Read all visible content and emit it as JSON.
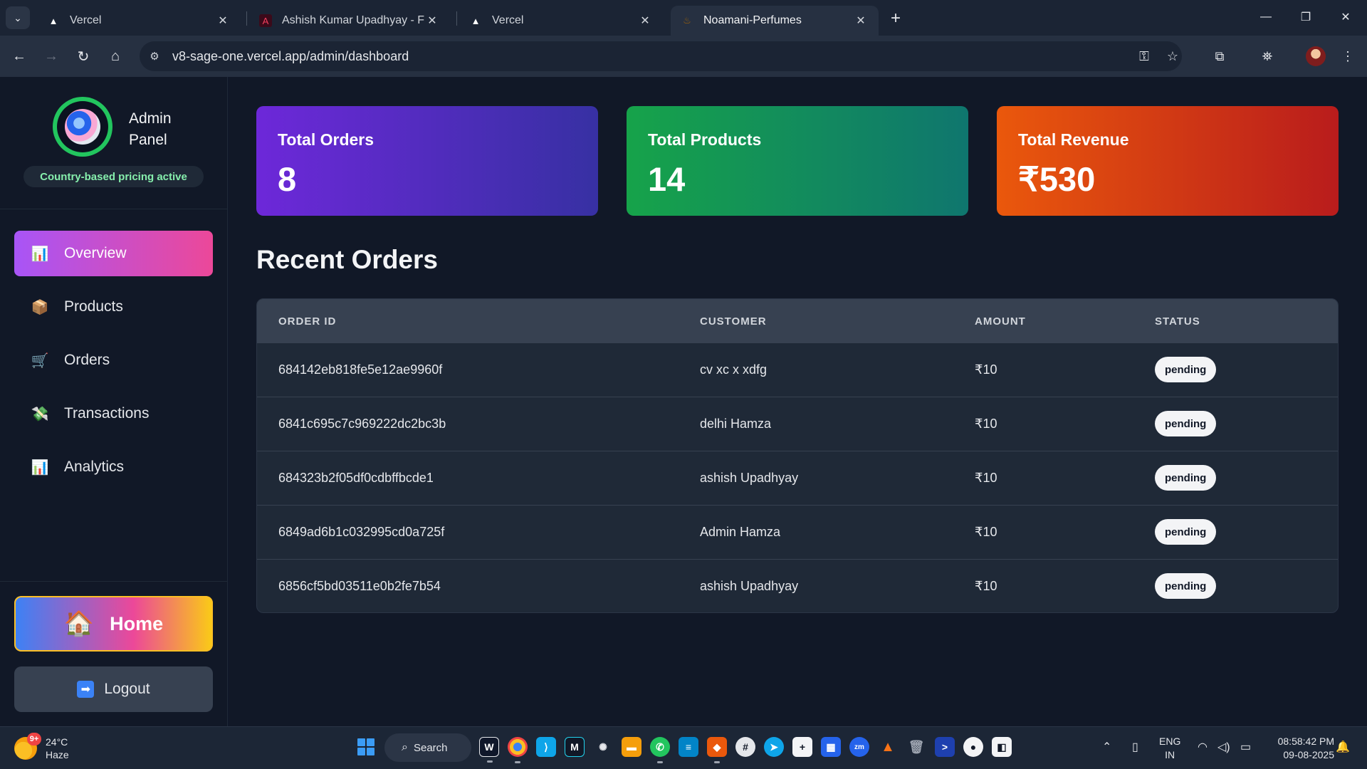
{
  "browser": {
    "tabs": [
      {
        "title": "Vercel",
        "icon": "vercel-logo"
      },
      {
        "title": "Ashish Kumar Upadhyay - Full S",
        "icon": "portfolio-favicon"
      },
      {
        "title": "Vercel",
        "icon": "vercel-logo"
      },
      {
        "title": "Noamani-Perfumes",
        "icon": "perfume-favicon",
        "active": true
      }
    ],
    "url": "v8-sage-one.vercel.app/admin/dashboard"
  },
  "sidebar": {
    "title": "Admin Panel",
    "pricing_badge": "Country-based pricing active",
    "nav": [
      {
        "label": "Overview",
        "icon": "📊",
        "active": true
      },
      {
        "label": "Products",
        "icon": "📦"
      },
      {
        "label": "Orders",
        "icon": "🛒"
      },
      {
        "label": "Transactions",
        "icon": "💸"
      },
      {
        "label": "Analytics",
        "icon": "📊"
      }
    ],
    "home_label": "Home",
    "home_icon": "🏠",
    "logout_label": "Logout",
    "logout_icon": "➡"
  },
  "stats": {
    "orders": {
      "label": "Total Orders",
      "value": "8"
    },
    "products": {
      "label": "Total Products",
      "value": "14"
    },
    "revenue": {
      "label": "Total Revenue",
      "value": "₹530"
    }
  },
  "recent_orders": {
    "title": "Recent Orders",
    "columns": [
      "ORDER ID",
      "CUSTOMER",
      "AMOUNT",
      "STATUS"
    ],
    "rows": [
      {
        "id": "684142eb818fe5e12ae9960f",
        "customer": "cv xc x xdfg",
        "amount": "₹10",
        "status": "pending"
      },
      {
        "id": "6841c695c7c969222dc2bc3b",
        "customer": "delhi Hamza",
        "amount": "₹10",
        "status": "pending"
      },
      {
        "id": "684323b2f05df0cdbffbcde1",
        "customer": "ashish Upadhyay",
        "amount": "₹10",
        "status": "pending"
      },
      {
        "id": "6849ad6b1c032995cd0a725f",
        "customer": "Admin Hamza",
        "amount": "₹10",
        "status": "pending"
      },
      {
        "id": "6856cf5bd03511e0b2fe7b54",
        "customer": "ashish Upadhyay",
        "amount": "₹10",
        "status": "pending"
      }
    ]
  },
  "taskbar": {
    "weather_temp": "24°C",
    "weather_desc": "Haze",
    "weather_badge": "9+",
    "search_label": "Search",
    "lang_1": "ENG",
    "lang_2": "IN",
    "time": "08:58:42 PM",
    "date": "09-08-2025"
  },
  "colors": {
    "sidebar_active": "#a855f7",
    "orders_card": "#6d28d9",
    "products_card": "#16a34a",
    "revenue_card": "#ea580c"
  }
}
